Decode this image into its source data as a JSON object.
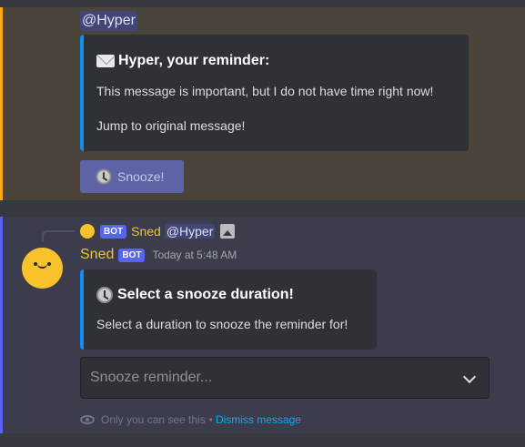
{
  "first_message": {
    "mention": "@Hyper",
    "embed": {
      "title_icon": "envelope-icon",
      "title": "Hyper, your  reminder:",
      "description": "This message is important, but I do not have time right now!",
      "link_text": "Jump to original message!"
    },
    "button": {
      "label": "Snooze!",
      "icon": "clock-icon"
    }
  },
  "second_message": {
    "reply": {
      "badge": "BOT",
      "author": "Sned",
      "mention": "@Hyper",
      "attachment_icon": "image-icon"
    },
    "author": "Sned",
    "badge": "BOT",
    "timestamp": "Today at 5:48 AM",
    "embed": {
      "title_icon": "clock-icon",
      "title": "Select a snooze duration!",
      "description": "Select a duration to snooze the reminder for!"
    },
    "select": {
      "placeholder": "Snooze reminder..."
    },
    "ephemeral": {
      "note": "Only you can see this",
      "separator": "•",
      "dismiss": "Dismiss message"
    }
  },
  "colors": {
    "background": "#36393f",
    "mention_highlight": "#4a443b",
    "mention_bar": "#faa81a",
    "ephemeral_bg": "#3b3d4d",
    "ephemeral_bar": "#5865f2",
    "embed_accent": "#0d8ff3",
    "bot_name": "#f1c232",
    "link": "#00aff4"
  }
}
